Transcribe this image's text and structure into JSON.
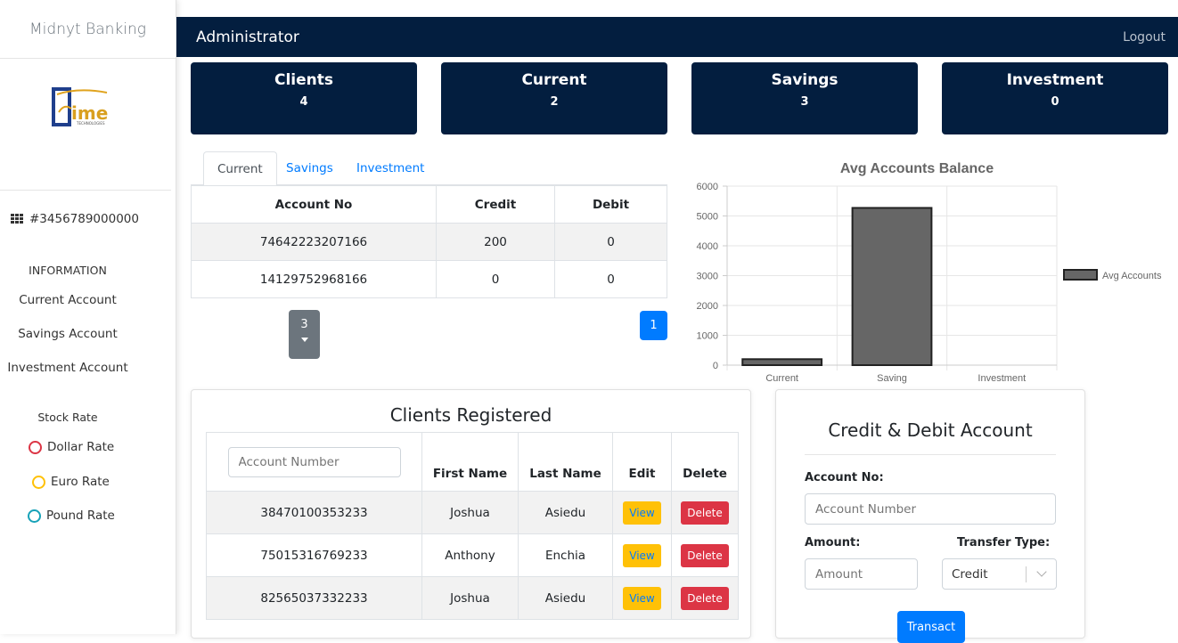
{
  "app": {
    "brand": "Midnyt Banking",
    "logo_text": "ime"
  },
  "sidebar": {
    "account_number": "#3456789000000",
    "info_heading": "INFORMATION",
    "links": [
      {
        "label": "Current Account"
      },
      {
        "label": "Savings Account"
      },
      {
        "label": "Investment Account"
      }
    ],
    "stock_heading": "Stock Rate",
    "rates": [
      {
        "label": "Dollar Rate",
        "color": "#dc3545"
      },
      {
        "label": "Euro Rate",
        "color": "#ffc107"
      },
      {
        "label": "Pound Rate",
        "color": "#17a2b8"
      }
    ]
  },
  "header": {
    "title": "Administrator",
    "logout": "Logout"
  },
  "stats": [
    {
      "label": "Clients",
      "value": "4"
    },
    {
      "label": "Current",
      "value": "2"
    },
    {
      "label": "Savings",
      "value": "3"
    },
    {
      "label": "Investment",
      "value": "0"
    }
  ],
  "tabs": [
    {
      "label": "Current",
      "active": true
    },
    {
      "label": "Savings",
      "active": false
    },
    {
      "label": "Investment",
      "active": false
    }
  ],
  "accounts_table": {
    "headers": [
      "Account No",
      "Credit",
      "Debit"
    ],
    "rows": [
      [
        "74642223207166",
        "200",
        "0"
      ],
      [
        "14129752968166",
        "0",
        "0"
      ]
    ]
  },
  "pagination": {
    "page_size": "3",
    "current_page": "1"
  },
  "chart_data": {
    "type": "bar",
    "title": "Avg Accounts Balance",
    "categories": [
      "Current",
      "Saving",
      "Investment"
    ],
    "series": [
      {
        "name": "Avg Accounts",
        "values": [
          200,
          5270,
          0
        ],
        "color": "#666666"
      }
    ],
    "ylim": [
      0,
      6000
    ],
    "yticks": [
      0,
      1000,
      2000,
      3000,
      4000,
      5000,
      6000
    ],
    "grid": true,
    "legend": "right"
  },
  "clients": {
    "title": "Clients Registered",
    "search_placeholder": "Account Number",
    "headers": [
      "First Name",
      "Last Name",
      "Edit",
      "Delete"
    ],
    "view_label": "View",
    "delete_label": "Delete",
    "rows": [
      {
        "account": "38470100353233",
        "first": "Joshua",
        "last": "Asiedu"
      },
      {
        "account": "75015316769233",
        "first": "Anthony",
        "last": "Enchia"
      },
      {
        "account": "82565037332233",
        "first": "Joshua",
        "last": "Asiedu"
      }
    ]
  },
  "credit_debit": {
    "title": "Credit & Debit Account",
    "account_label": "Account No:",
    "account_placeholder": "Account Number",
    "amount_label": "Amount:",
    "amount_placeholder": "Amount",
    "transfer_label": "Transfer Type:",
    "transfer_value": "Credit",
    "submit_label": "Transact"
  }
}
